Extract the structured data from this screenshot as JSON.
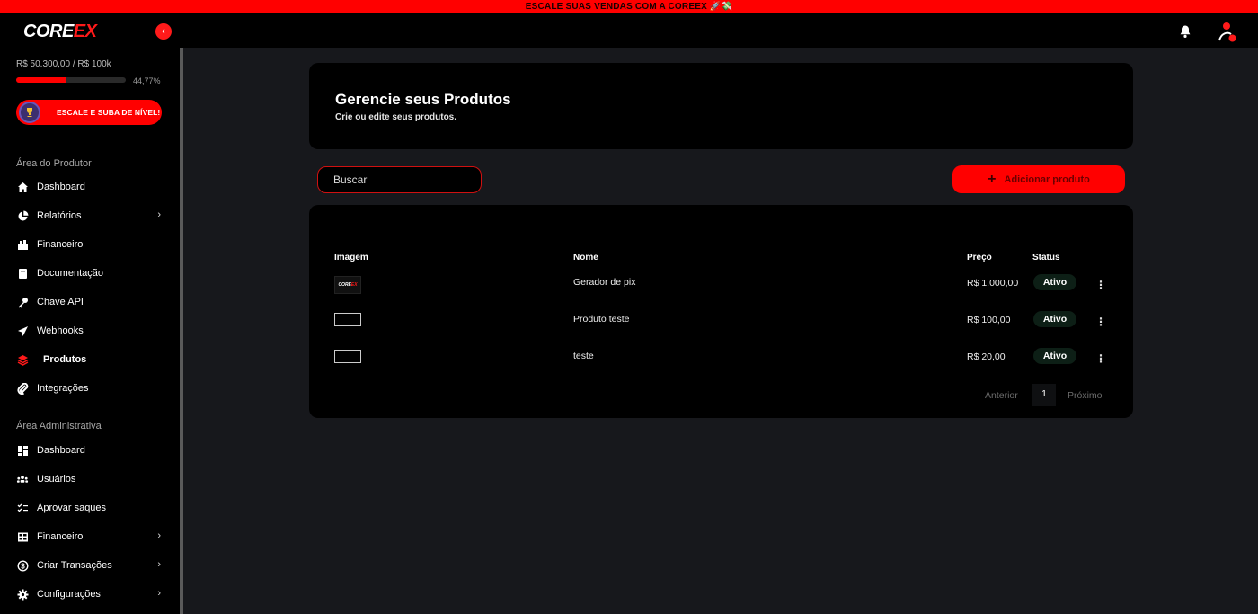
{
  "banner": {
    "text": "ESCALE SUAS VENDAS COM A COREEX 🚀💸"
  },
  "brand": {
    "part1": "CORE",
    "part2": "EX",
    "accent": "#ff0000"
  },
  "topbar": {
    "collapse_icon": "chevron-left-icon",
    "notifications_icon": "bell-icon",
    "user_icon": "user-icon"
  },
  "sidebar": {
    "goal_text": "R$ 50.300,00 / R$ 100k",
    "goal_percent_label": "44,77%",
    "goal_fraction": 0.4477,
    "level_button": "ESCALE E SUBA DE NÍVEL!",
    "sections": [
      {
        "title": "Área do Produtor",
        "items": [
          {
            "label": "Dashboard",
            "icon": "home-icon"
          },
          {
            "label": "Relatórios",
            "icon": "pie-chart-icon",
            "has_submenu": true
          },
          {
            "label": "Financeiro",
            "icon": "wallet-icon"
          },
          {
            "label": "Documentação",
            "icon": "book-icon"
          },
          {
            "label": "Chave API",
            "icon": "key-icon"
          },
          {
            "label": "Webhooks",
            "icon": "send-icon"
          },
          {
            "label": "Produtos",
            "icon": "layers-icon",
            "active": true
          },
          {
            "label": "Integrações",
            "icon": "paperclip-icon"
          }
        ]
      },
      {
        "title": "Área Administrativa",
        "items": [
          {
            "label": "Dashboard",
            "icon": "dashboard-grid-icon"
          },
          {
            "label": "Usuários",
            "icon": "users-icon"
          },
          {
            "label": "Aprovar saques",
            "icon": "checklist-icon"
          },
          {
            "label": "Financeiro",
            "icon": "table-icon",
            "has_submenu": true
          },
          {
            "label": "Criar Transações",
            "icon": "exchange-icon",
            "has_submenu": true
          },
          {
            "label": "Configurações",
            "icon": "gear-icon",
            "has_submenu": true
          }
        ]
      }
    ]
  },
  "main": {
    "title": "Gerencie seus Produtos",
    "subtitle": "Crie ou edite seus produtos.",
    "search": {
      "placeholder": "Buscar"
    },
    "add_button": "Adicionar produto",
    "table": {
      "headers": {
        "image": "Imagem",
        "name": "Nome",
        "price": "Preço",
        "status": "Status"
      },
      "rows": [
        {
          "image": "coreex-logo",
          "name": "Gerador de pix",
          "price": "R$ 1.000,00",
          "status": "Ativo"
        },
        {
          "image": "broken-image",
          "name": "Produto teste",
          "price": "R$ 100,00",
          "status": "Ativo"
        },
        {
          "image": "broken-image",
          "name": "teste",
          "price": "R$ 20,00",
          "status": "Ativo"
        }
      ]
    },
    "pagination": {
      "prev": "Anterior",
      "current": "1",
      "next": "Próximo"
    }
  }
}
